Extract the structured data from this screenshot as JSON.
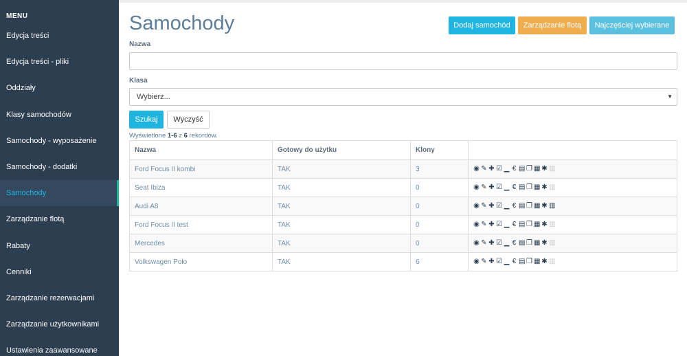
{
  "sidebar": {
    "menu_title": "MENU",
    "items": [
      {
        "label": "Edycja treści"
      },
      {
        "label": "Edycja treści - pliki"
      },
      {
        "label": "Oddziały"
      },
      {
        "label": "Klasy samochodów"
      },
      {
        "label": "Samochody - wyposażenie"
      },
      {
        "label": "Samochody - dodatki"
      },
      {
        "label": "Samochody"
      },
      {
        "label": "Zarządzanie flotą"
      },
      {
        "label": "Rabaty"
      },
      {
        "label": "Cenniki"
      },
      {
        "label": "Zarządzanie rezerwacjami"
      },
      {
        "label": "Zarządzanie użytkownikami"
      },
      {
        "label": "Ustawienia zaawansowane"
      }
    ],
    "active_index": 6
  },
  "header": {
    "title": "Samochody",
    "buttons": {
      "add": "Dodaj samochód",
      "fleet": "Zarządzanie flotą",
      "popular": "Najczęściej wybierane"
    }
  },
  "filters": {
    "name_label": "Nazwa",
    "name_value": "",
    "class_label": "Klasa",
    "class_value": "Wybierz...",
    "search_label": "Szukaj",
    "clear_label": "Wyczyść"
  },
  "summary": {
    "prefix": "Wyświetlone ",
    "range": "1-6",
    "middle": " z ",
    "total": "6",
    "suffix": " rekordów."
  },
  "table": {
    "columns": [
      "Nazwa",
      "Gotowy do użytku",
      "Klony",
      ""
    ],
    "rows": [
      {
        "name": "Ford Focus II kombi",
        "ready": "TAK",
        "clones": "3",
        "delete_enabled": false
      },
      {
        "name": "Seat Ibiza",
        "ready": "TAK",
        "clones": "0",
        "delete_enabled": false
      },
      {
        "name": "Audi A8",
        "ready": "TAK",
        "clones": "0",
        "delete_enabled": true
      },
      {
        "name": "Ford Focus II test",
        "ready": "TAK",
        "clones": "0",
        "delete_enabled": false
      },
      {
        "name": "Mercedes",
        "ready": "TAK",
        "clones": "0",
        "delete_enabled": false
      },
      {
        "name": "Volkswagen Polo",
        "ready": "TAK",
        "clones": "6",
        "delete_enabled": false
      }
    ],
    "action_icons": [
      "eye-icon",
      "pencil-icon",
      "plus-icon",
      "check-square-icon",
      "signal-icon",
      "euro-icon",
      "film-icon",
      "copy-icon",
      "calendar-icon",
      "wrench-icon",
      "trash-icon"
    ]
  },
  "colors": {
    "sidebar_bg": "#2c3e50",
    "sidebar_active_bg": "#34495e",
    "sidebar_active_text": "#1fb5e8",
    "sidebar_active_marker": "#1abc9c",
    "primary": "#1fb5e0",
    "warning": "#f0ad4e",
    "info": "#5bc0de",
    "title": "#5e7d98"
  }
}
